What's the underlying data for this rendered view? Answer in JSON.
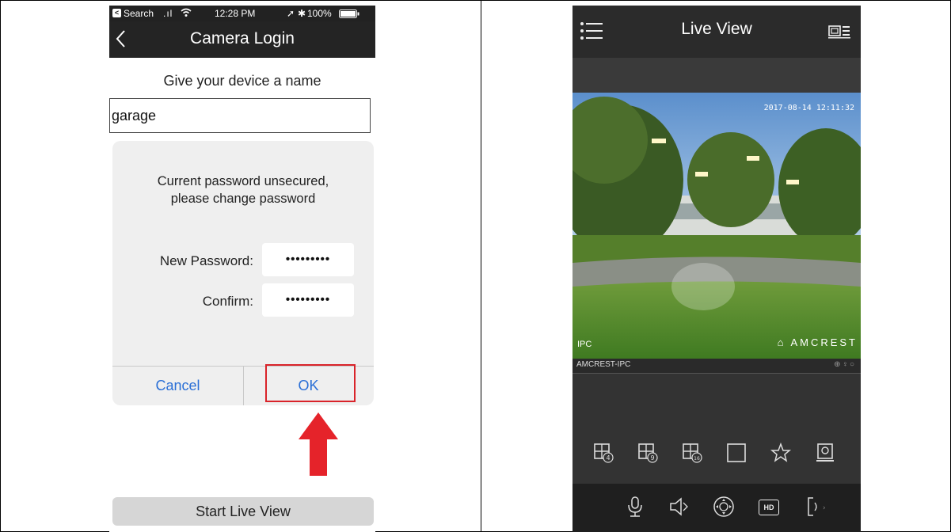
{
  "left_screen": {
    "status_bar": {
      "back_app": "Search",
      "time": "12:28 PM",
      "battery": "100%"
    },
    "nav": {
      "title": "Camera Login"
    },
    "device_name": {
      "label": "Give your device a name",
      "value": "garage"
    },
    "dialog": {
      "message_line1": "Current password unsecured,",
      "message_line2": "please change password",
      "new_password_label": "New Password:",
      "new_password_value": "•••••••••",
      "confirm_label": "Confirm:",
      "confirm_value": "•••••••••",
      "cancel_label": "Cancel",
      "ok_label": "OK"
    },
    "start_live_view_label": "Start Live View",
    "colors": {
      "accent": "#2a6fd6",
      "highlight": "#d9232a"
    }
  },
  "right_screen": {
    "header": {
      "title": "Live View",
      "menu_icon": "menu-icon",
      "device_icon": "device-list-icon"
    },
    "camera": {
      "timestamp": "2017-08-14 12:11:32",
      "channel_label": "IPC",
      "brand": "AMCREST",
      "device_name": "AMCREST-IPC"
    },
    "view_toolbar": [
      "split-4-icon",
      "split-9-icon",
      "split-16-icon",
      "single-view-icon",
      "favorite-star-icon",
      "snapshot-icon"
    ],
    "bottom_toolbar": [
      "microphone-icon",
      "speaker-icon",
      "ptz-icon",
      "hd-icon",
      "more-icon"
    ],
    "hd_label": "HD"
  }
}
